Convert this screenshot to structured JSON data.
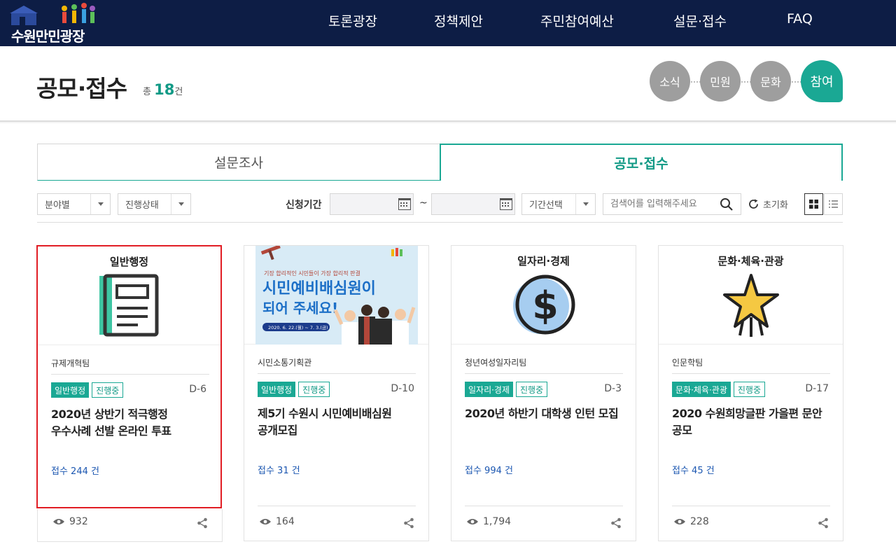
{
  "nav": {
    "logo_text": "수원만민광장",
    "items": [
      {
        "label": "토론광장"
      },
      {
        "label": "정책제안"
      },
      {
        "label": "주민참여예산"
      },
      {
        "label": "설문·접수"
      },
      {
        "label": "FAQ"
      }
    ]
  },
  "header": {
    "title": "공모·접수",
    "count_prefix": "총",
    "count_value": "18",
    "count_suffix": "건",
    "steps": [
      {
        "label": "소식"
      },
      {
        "label": "민원"
      },
      {
        "label": "문화"
      },
      {
        "label": "참여"
      }
    ]
  },
  "tabs": [
    {
      "label": "설문조사",
      "active": false
    },
    {
      "label": "공모·접수",
      "active": true
    }
  ],
  "filters": {
    "field": "분야별",
    "status": "진행상태",
    "period_label": "신청기간",
    "tilde": "~",
    "period_select": "기간선택",
    "search_placeholder": "검색어를 입력해주세요",
    "reset": "초기화"
  },
  "cards": [
    {
      "category": "일반행정",
      "dept": "규제개혁팀",
      "badge_category": "일반행정",
      "badge_status": "진행중",
      "dday": "D-6",
      "title": "2020년 상반기 적극행정 우수사례 선발 온라인 투표",
      "receipt": "접수 244 건",
      "views": "932",
      "icon": "newspaper-icon"
    },
    {
      "category": "",
      "dept": "시민소통기획관",
      "badge_category": "일반행정",
      "badge_status": "진행중",
      "dday": "D-10",
      "title": "제5기 수원시 시민예비배심원 공개모집",
      "receipt": "접수 31 건",
      "views": "164",
      "image": {
        "tagline": "기장 합리적인 시민들이 가장 합리적 판결",
        "headline1": "시민예비배심원이",
        "headline2": "되어 주세요!",
        "dates": "2020. 6. 22.(월) ~ 7. 3.(금)"
      }
    },
    {
      "category": "일자리·경제",
      "dept": "청년여성일자리팀",
      "badge_category": "일자리·경제",
      "badge_status": "진행중",
      "dday": "D-3",
      "title": "2020년 하반기 대학생 인턴 모집",
      "receipt": "접수 994 건",
      "views": "1,794",
      "icon": "dollar-coin-icon"
    },
    {
      "category": "문화·체육·관광",
      "dept": "인문학팀",
      "badge_category": "문화·체육·관광",
      "badge_status": "진행중",
      "dday": "D-17",
      "title": "2020 수원희망글판 가을편 문안 공모",
      "receipt": "접수 45 건",
      "views": "228",
      "icon": "shooting-star-icon"
    }
  ],
  "colors": {
    "nav_bg": "#0d1d45",
    "accent": "#1aa894",
    "highlight": "#e11d24",
    "link_blue": "#1c57b1"
  }
}
